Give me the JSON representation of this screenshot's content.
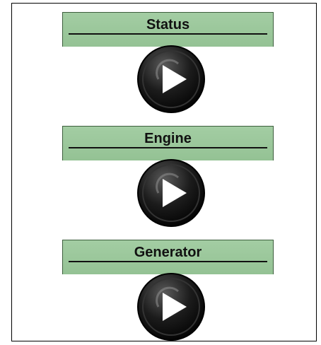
{
  "sections": [
    {
      "label": "Status",
      "button_icon": "play-icon"
    },
    {
      "label": "Engine",
      "button_icon": "play-icon"
    },
    {
      "label": "Generator",
      "button_icon": "play-icon"
    }
  ],
  "colors": {
    "label_bar": "#9cc89c",
    "button_ring": "#1a1a1a",
    "play_glyph": "#ffffff"
  }
}
